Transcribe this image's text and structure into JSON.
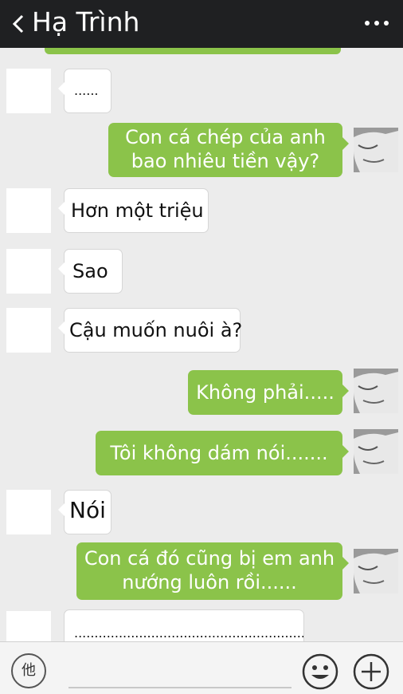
{
  "header": {
    "title": "Hạ Trình",
    "back_icon": "chevron-left-icon",
    "more_icon": "more-dots-icon"
  },
  "messages": [
    {
      "side": "in",
      "text": "......"
    },
    {
      "side": "out",
      "lines": [
        "Con cá chép của anh",
        "bao nhiêu tiền vậy?"
      ]
    },
    {
      "side": "in",
      "text": "Hơn một triệu"
    },
    {
      "side": "in",
      "text": "Sao"
    },
    {
      "side": "in",
      "text": "Cậu muốn nuôi à?"
    },
    {
      "side": "out",
      "lines": [
        "Không phải....."
      ]
    },
    {
      "side": "out",
      "lines": [
        "Tôi không dám nói......."
      ]
    },
    {
      "side": "in",
      "text": "Nói"
    },
    {
      "side": "out",
      "lines": [
        "Con cá đó cũng bị em anh",
        "nướng luôn rồi......"
      ]
    },
    {
      "side": "in",
      "text": "..........................................................."
    }
  ],
  "footer": {
    "voice_label": "他",
    "emoji_icon": "smiley-icon",
    "plus_icon": "plus-icon"
  },
  "colors": {
    "header_bg": "#1f2022",
    "outgoing_bubble": "#8bc34a",
    "chat_bg": "#ececec"
  }
}
